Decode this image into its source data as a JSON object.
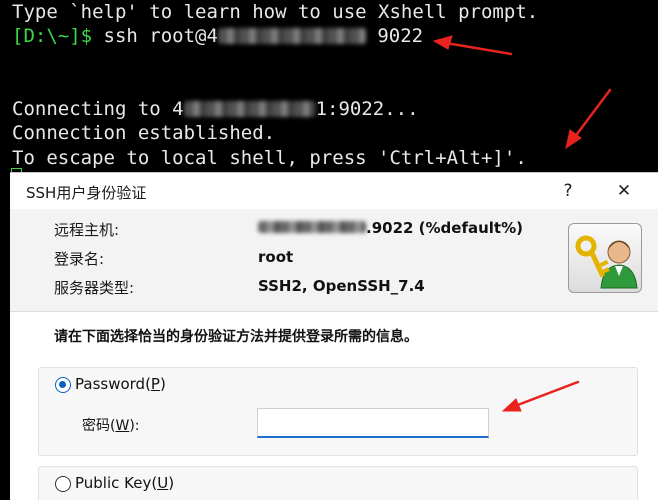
{
  "terminal": {
    "line1": "Type `help' to learn how to use Xshell prompt.",
    "prompt": "[D:\\~]$",
    "command_prefix": " ssh root@4",
    "command_suffix": " 9022",
    "connecting_prefix": "Connecting to 4",
    "connecting_suffix": "1:9022...",
    "established": "Connection established.",
    "escape_hint": "To escape to local shell, press 'Ctrl+Alt+]'."
  },
  "dialog": {
    "title": "SSH用户身份验证",
    "help_button": "?",
    "close_button": "✕",
    "info": {
      "host_label": "远程主机:",
      "host_value_suffix": ".9022 (%default%)",
      "login_label": "登录名:",
      "login_value": "root",
      "server_type_label": "服务器类型:",
      "server_type_value": "SSH2, OpenSSH_7.4"
    },
    "instruction": "请在下面选择恰当的身份验证方法并提供登录所需的信息。",
    "password_option": {
      "label_prefix": "Password(",
      "hotkey": "P",
      "label_suffix": ")",
      "selected": true
    },
    "password_field": {
      "label_prefix": "密码(",
      "hotkey": "W",
      "label_suffix": "):",
      "value": ""
    },
    "public_key_option": {
      "label_prefix": "Public Key(",
      "hotkey": "U",
      "label_suffix": ")",
      "selected": false
    }
  },
  "colors": {
    "terminal_bg": "#000000",
    "terminal_text": "#e8e8e8",
    "prompt_green": "#3bd64a",
    "accent_blue": "#0a5ec2",
    "annotation_red": "#e8231e"
  },
  "icons": {
    "user_avatar": "user-key-icon"
  }
}
